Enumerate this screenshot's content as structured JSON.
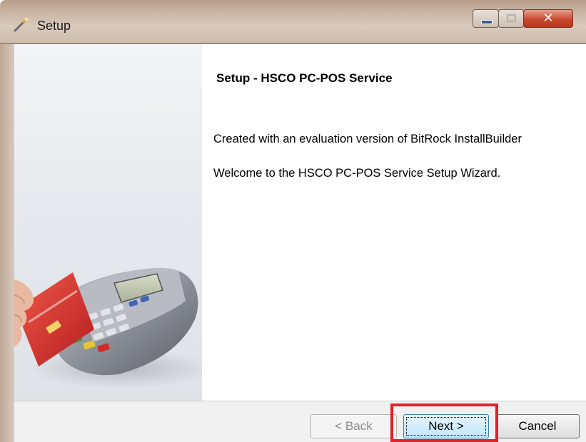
{
  "window": {
    "title": "Setup",
    "controls": [
      "minimize",
      "maximize",
      "close"
    ]
  },
  "main": {
    "heading": "Setup - HSCO PC-POS Service",
    "lines": [
      "Created with an evaluation version of BitRock InstallBuilder",
      "Welcome to the HSCO PC-POS Service  Setup Wizard."
    ]
  },
  "buttons": {
    "back": "< Back",
    "next": "Next >",
    "cancel": "Cancel"
  },
  "colors": {
    "highlight": "#e0222a",
    "card_red": "#d8262c",
    "terminal_gray": "#9a9ea6"
  },
  "icons": {
    "app": "setup-wand-icon",
    "close": "close-icon",
    "minimize": "minimize-icon",
    "maximize": "maximize-icon"
  }
}
